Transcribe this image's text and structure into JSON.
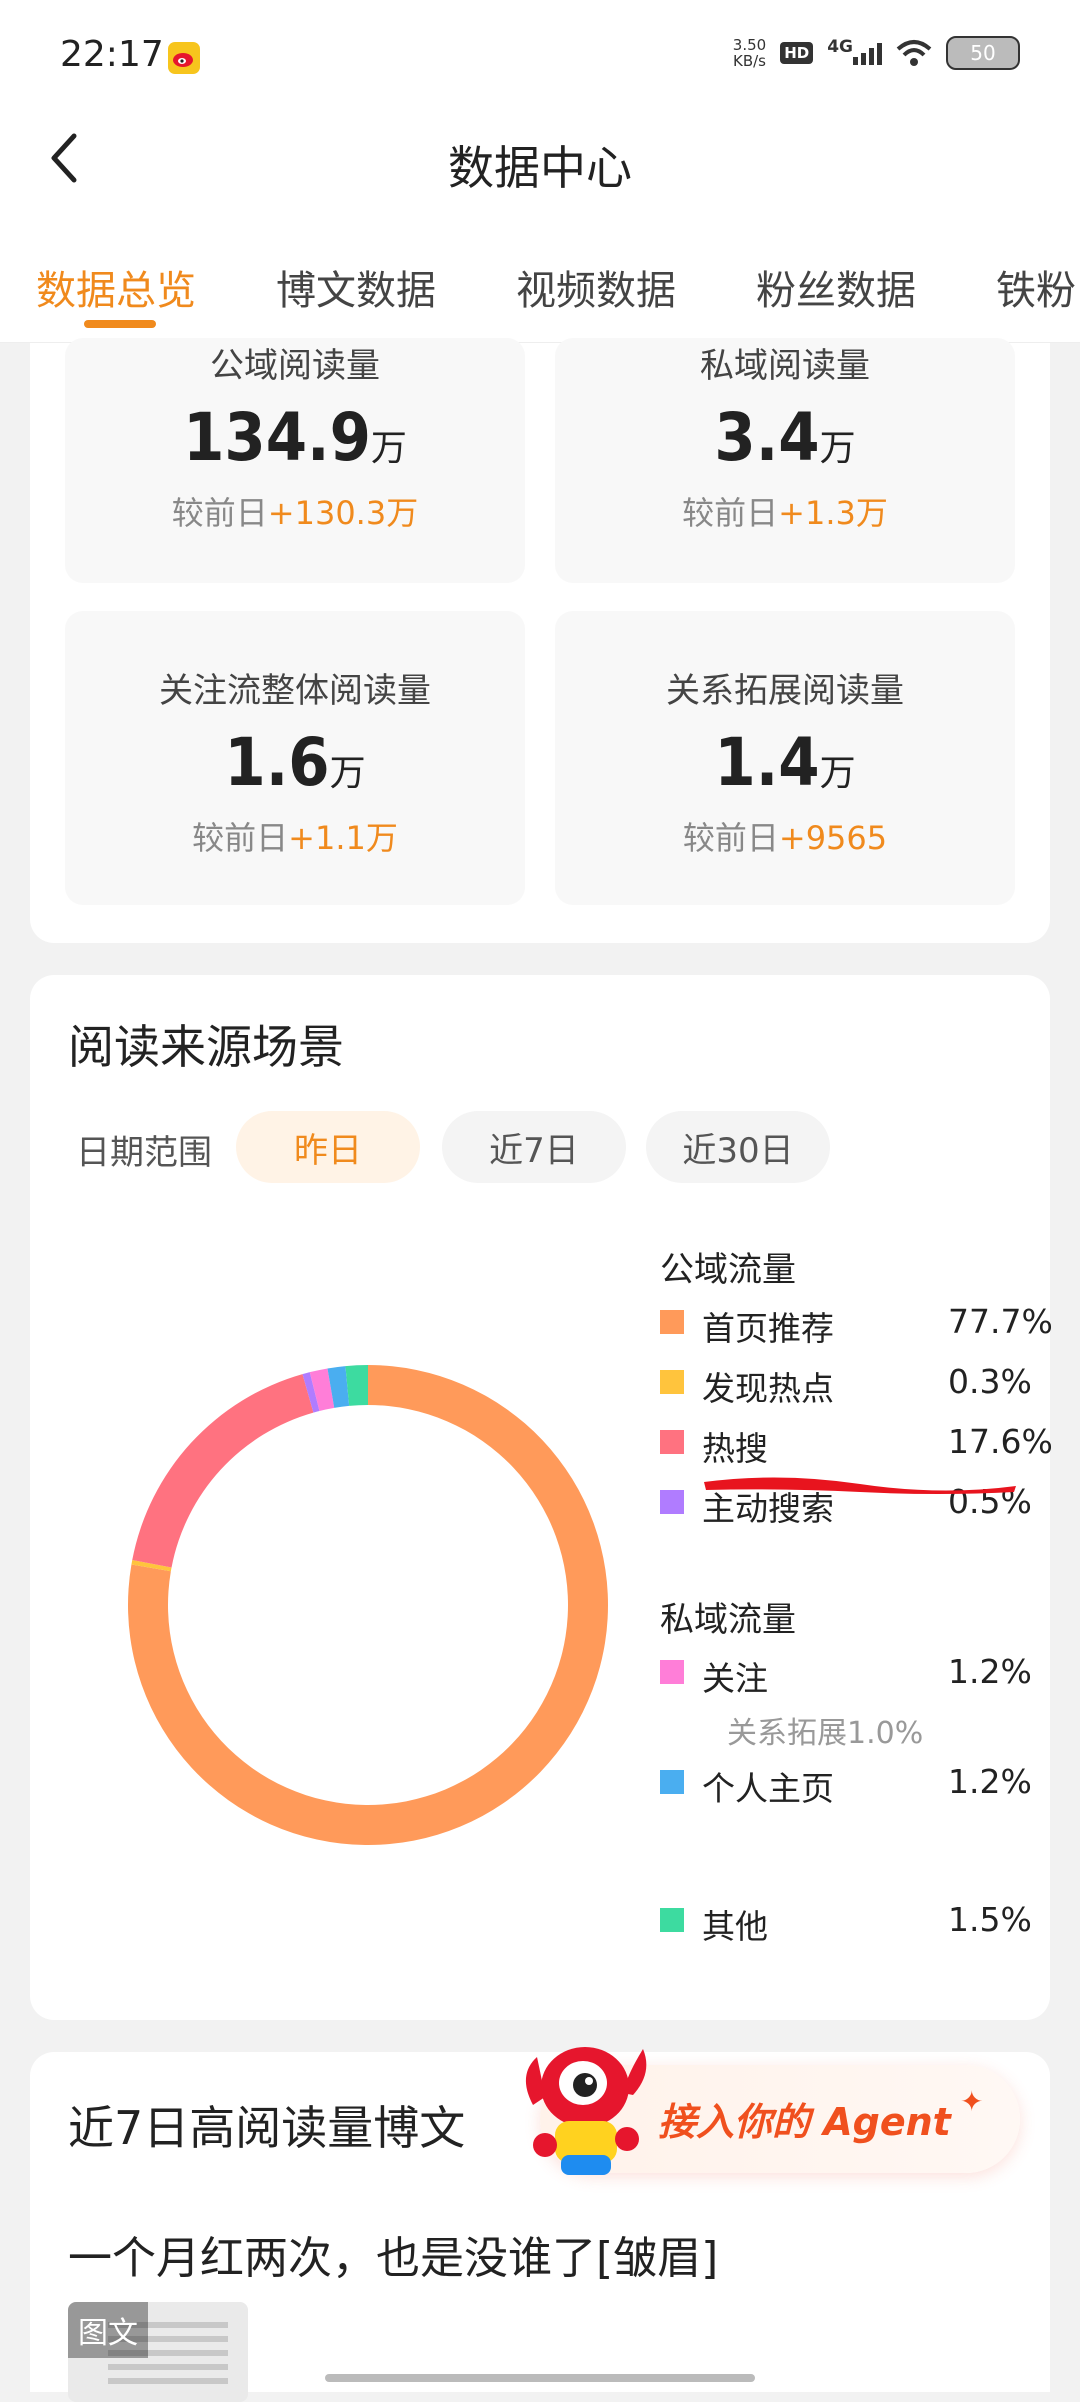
{
  "status_bar": {
    "time": "22:17",
    "net_speed_value": "3.50",
    "net_speed_unit": "KB/s",
    "hd": "HD",
    "network": "4G",
    "battery": "50"
  },
  "header": {
    "title": "数据中心"
  },
  "tabs": [
    {
      "label": "数据总览",
      "active": true
    },
    {
      "label": "博文数据"
    },
    {
      "label": "视频数据"
    },
    {
      "label": "粉丝数据"
    },
    {
      "label": "铁粉"
    }
  ],
  "stats": [
    {
      "label": "公域阅读量",
      "value": "134.9",
      "unit": "万",
      "diff_prefix": "较前日",
      "diff": "+130.3万"
    },
    {
      "label": "私域阅读量",
      "value": "3.4",
      "unit": "万",
      "diff_prefix": "较前日",
      "diff": "+1.3万"
    },
    {
      "label": "关注流整体阅读量",
      "value": "1.6",
      "unit": "万",
      "diff_prefix": "较前日",
      "diff": "+1.1万"
    },
    {
      "label": "关系拓展阅读量",
      "value": "1.4",
      "unit": "万",
      "diff_prefix": "较前日",
      "diff": "+9565"
    }
  ],
  "source_section": {
    "title": "阅读来源场景",
    "date_label": "日期范围",
    "chips": [
      "昨日",
      "近7日",
      "近30日"
    ],
    "public_title": "公域流量",
    "private_title": "私域流量",
    "legend": [
      {
        "name": "首页推荐",
        "pct": "77.7%",
        "color": "#ff9a5a"
      },
      {
        "name": "发现热点",
        "pct": "0.3%",
        "color": "#ffc43d"
      },
      {
        "name": "热搜",
        "pct": "17.6%",
        "color": "#ff7280"
      },
      {
        "name": "主动搜索",
        "pct": "0.5%",
        "color": "#b07cff"
      },
      {
        "name": "关注",
        "pct": "1.2%",
        "color": "#ff7ed8"
      },
      {
        "name": "个人主页",
        "pct": "1.2%",
        "color": "#4aaef0"
      },
      {
        "name": "其他",
        "pct": "1.5%",
        "color": "#3ddba0"
      }
    ],
    "follow_sub": "关系拓展1.0%"
  },
  "chart_data": {
    "type": "pie",
    "categories": [
      "首页推荐",
      "发现热点",
      "热搜",
      "主动搜索",
      "关注",
      "个人主页",
      "其他"
    ],
    "values": [
      77.7,
      0.3,
      17.6,
      0.5,
      1.2,
      1.2,
      1.5
    ],
    "colors": [
      "#ff9a5a",
      "#ffc43d",
      "#ff7280",
      "#b07cff",
      "#ff7ed8",
      "#4aaef0",
      "#3ddba0"
    ]
  },
  "top_posts": {
    "title": "近7日高阅读量博文",
    "post_title": "一个月红两次，也是没谁了[皱眉]",
    "thumb_badge": "图文"
  },
  "agent_banner": {
    "text": "接入你的 Agent"
  }
}
